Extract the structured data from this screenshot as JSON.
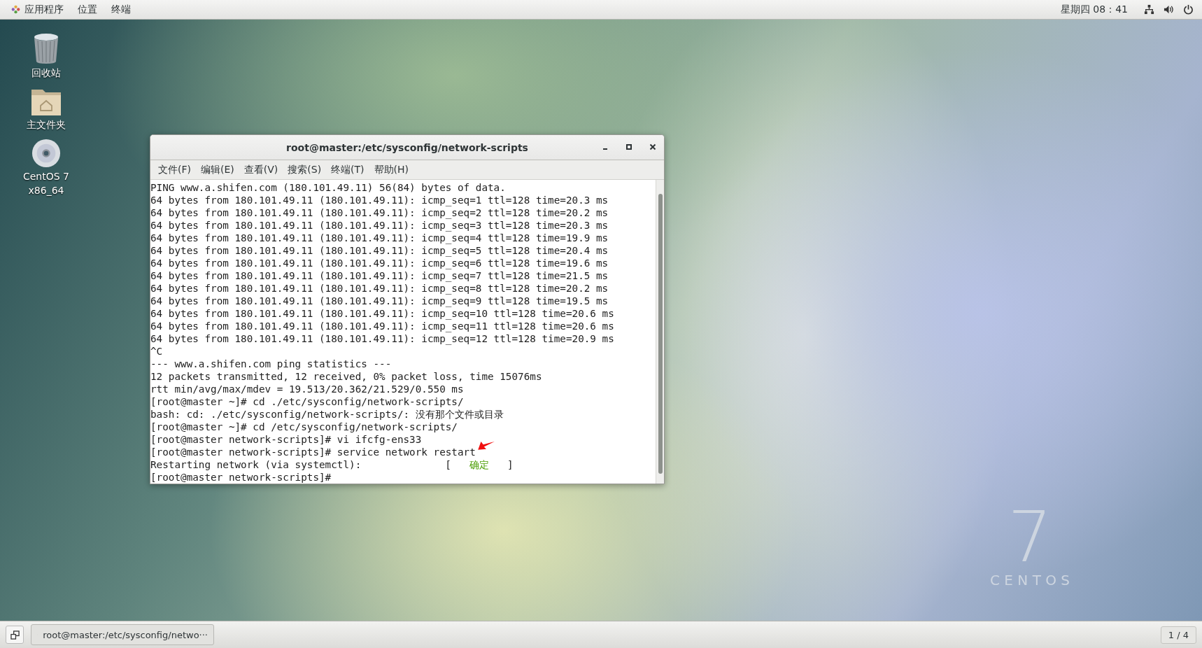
{
  "top_bar": {
    "menus": [
      {
        "label": "应用程序",
        "kind": "apps"
      },
      {
        "label": "位置",
        "kind": "plain"
      },
      {
        "label": "终端",
        "kind": "plain"
      }
    ],
    "clock": "星期四 08：41"
  },
  "desktop_icons": [
    {
      "label": "回收站",
      "kind": "trash"
    },
    {
      "label": "主文件夹",
      "kind": "folder"
    },
    {
      "label": "CentOS 7\nx86_64",
      "kind": "disc"
    }
  ],
  "wallpaper_logo": {
    "number": "7",
    "name": "C E N T O S"
  },
  "terminal": {
    "title": "root@master:/etc/sysconfig/network-scripts",
    "menus": [
      "文件(F)",
      "编辑(E)",
      "查看(V)",
      "搜索(S)",
      "终端(T)",
      "帮助(H)"
    ],
    "lines": [
      {
        "text": "PING www.a.shifen.com (180.101.49.11) 56(84) bytes of data."
      },
      {
        "text": "64 bytes from 180.101.49.11 (180.101.49.11): icmp_seq=1 ttl=128 time=20.3 ms"
      },
      {
        "text": "64 bytes from 180.101.49.11 (180.101.49.11): icmp_seq=2 ttl=128 time=20.2 ms"
      },
      {
        "text": "64 bytes from 180.101.49.11 (180.101.49.11): icmp_seq=3 ttl=128 time=20.3 ms"
      },
      {
        "text": "64 bytes from 180.101.49.11 (180.101.49.11): icmp_seq=4 ttl=128 time=19.9 ms"
      },
      {
        "text": "64 bytes from 180.101.49.11 (180.101.49.11): icmp_seq=5 ttl=128 time=20.4 ms"
      },
      {
        "text": "64 bytes from 180.101.49.11 (180.101.49.11): icmp_seq=6 ttl=128 time=19.6 ms"
      },
      {
        "text": "64 bytes from 180.101.49.11 (180.101.49.11): icmp_seq=7 ttl=128 time=21.5 ms"
      },
      {
        "text": "64 bytes from 180.101.49.11 (180.101.49.11): icmp_seq=8 ttl=128 time=20.2 ms"
      },
      {
        "text": "64 bytes from 180.101.49.11 (180.101.49.11): icmp_seq=9 ttl=128 time=19.5 ms"
      },
      {
        "text": "64 bytes from 180.101.49.11 (180.101.49.11): icmp_seq=10 ttl=128 time=20.6 ms"
      },
      {
        "text": "64 bytes from 180.101.49.11 (180.101.49.11): icmp_seq=11 ttl=128 time=20.6 ms"
      },
      {
        "text": "64 bytes from 180.101.49.11 (180.101.49.11): icmp_seq=12 ttl=128 time=20.9 ms"
      },
      {
        "text": "^C"
      },
      {
        "text": "--- www.a.shifen.com ping statistics ---"
      },
      {
        "text": "12 packets transmitted, 12 received, 0% packet loss, time 15076ms"
      },
      {
        "text": "rtt min/avg/max/mdev = 19.513/20.362/21.529/0.550 ms"
      },
      {
        "text": "[root@master ~]# cd ./etc/sysconfig/network-scripts/"
      },
      {
        "text": "bash: cd: ./etc/sysconfig/network-scripts/: 没有那个文件或目录"
      },
      {
        "text": "[root@master ~]# cd /etc/sysconfig/network-scripts/"
      },
      {
        "text": "[root@master network-scripts]# vi ifcfg-ens33"
      },
      {
        "text": "[root@master network-scripts]# service network restart",
        "arrow": true
      },
      {
        "text": "Restarting network (via systemctl):",
        "status_open": "[",
        "status": "确定",
        "status_close": "]"
      },
      {
        "text": "[root@master network-scripts]#"
      }
    ]
  },
  "taskbar": {
    "windows": [
      {
        "label": "root@master:/etc/sysconfig/netwo···",
        "selected": false
      }
    ],
    "workspace": "1 / 4"
  }
}
